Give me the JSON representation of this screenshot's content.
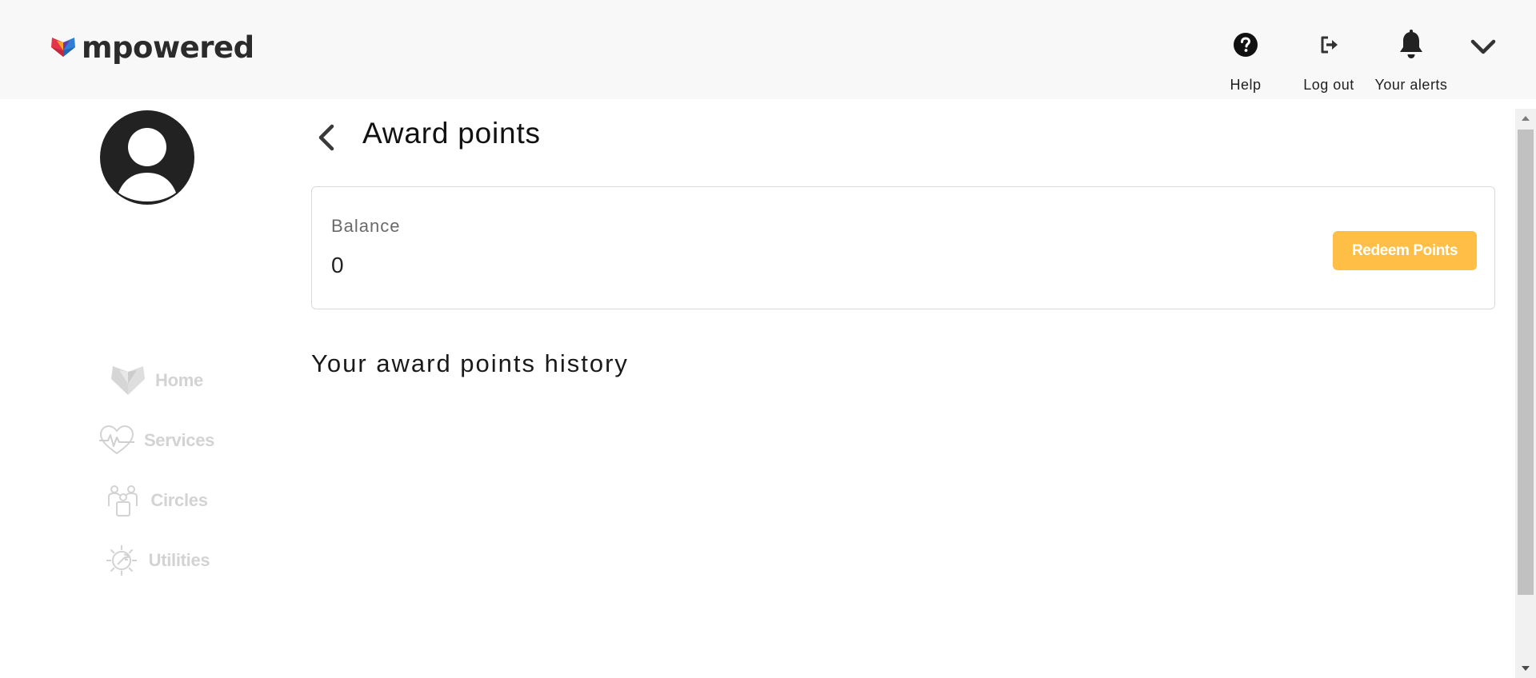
{
  "app": {
    "logo_text": "mpowered",
    "brand_colors": [
      "#e5344a",
      "#2f7fd6",
      "#f5a623",
      "#6c3aa8"
    ]
  },
  "header": {
    "actions": [
      {
        "label": "Help",
        "icon": "help-circle-icon"
      },
      {
        "label": "Log out",
        "icon": "logout-icon"
      },
      {
        "label": "Your alerts",
        "icon": "bell-icon"
      }
    ],
    "menu_icon": "chevron-down-icon"
  },
  "sidebar": {
    "avatar_icon": "user-avatar-icon",
    "items": [
      {
        "label": "Home",
        "icon": "heart-home-icon"
      },
      {
        "label": "Services",
        "icon": "heartbeat-icon"
      },
      {
        "label": "Circles",
        "icon": "people-group-icon"
      },
      {
        "label": "Utilities",
        "icon": "gear-wrench-icon"
      }
    ],
    "item_color": "#d3d3d3"
  },
  "main": {
    "title": "Award points",
    "back_icon": "chevron-left-icon",
    "balance": {
      "label": "Balance",
      "value": "0",
      "redeem_label": "Redeem Points",
      "redeem_color": "#ffbf46"
    },
    "history_title": "Your award points history"
  }
}
